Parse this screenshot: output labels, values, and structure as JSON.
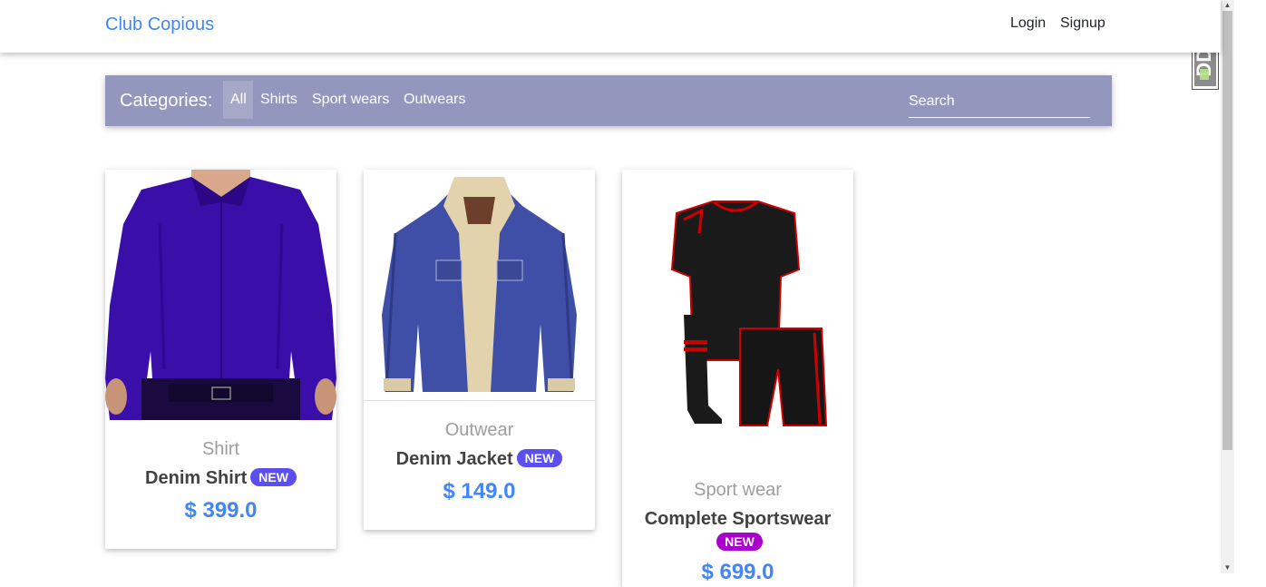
{
  "header": {
    "brand": "Club Copious",
    "login": "Login",
    "signup": "Signup"
  },
  "categories": {
    "label": "Categories:",
    "items": [
      "All",
      "Shirts",
      "Sport wears",
      "Outwears"
    ],
    "active": "All",
    "search_placeholder": "Search"
  },
  "products": [
    {
      "category": "Shirt",
      "name": "Denim Shirt",
      "badge": "NEW",
      "price": "$ 399.0",
      "image": "blue-shirt-image"
    },
    {
      "category": "Outwear",
      "name": "Denim Jacket",
      "badge": "NEW",
      "price": "$ 149.0",
      "image": "denim-jacket-image"
    },
    {
      "category": "Sport wear",
      "name": "Complete Sportswear",
      "badge": "NEW",
      "price": "$ 699.0",
      "image": "sportswear-kit-image"
    }
  ],
  "colors": {
    "brand": "#4285f4",
    "category_bar": "#9397bd",
    "badge_blue": "#5b4ff0",
    "badge_purple": "#aa00cc"
  },
  "extension_icon": {
    "text": "DDT",
    "icon": "ddt-extension-icon"
  }
}
